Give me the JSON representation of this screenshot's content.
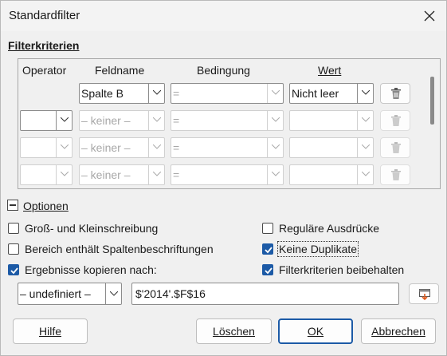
{
  "window": {
    "title": "Standardfilter"
  },
  "criteria": {
    "title": "Filterkriterien",
    "headers": {
      "operator": "Operator",
      "field": "Feldname",
      "condition": "Bedingung",
      "value": "Wert"
    },
    "rows": [
      {
        "operator": "",
        "field": "Spalte B",
        "condition": "=",
        "value": "Nicht leer",
        "enabled": true
      },
      {
        "operator": "",
        "field": "– keiner –",
        "condition": "=",
        "value": "",
        "enabled": false
      },
      {
        "operator": "",
        "field": "– keiner –",
        "condition": "=",
        "value": "",
        "enabled": false
      },
      {
        "operator": "",
        "field": "– keiner –",
        "condition": "=",
        "value": "",
        "enabled": false
      }
    ]
  },
  "options": {
    "title": "Optionen",
    "case_sensitive": {
      "label": "Groß- und Kleinschreibung",
      "checked": false
    },
    "regex": {
      "label": "Reguläre Ausdrücke",
      "checked": false
    },
    "range_has_headers": {
      "label": "Bereich enthält Spaltenbeschriftungen",
      "checked": false
    },
    "no_duplicates": {
      "label": "Keine Duplikate",
      "checked": true
    },
    "copy_results": {
      "label": "Ergebnisse kopieren nach:",
      "checked": true
    },
    "keep_criteria": {
      "label": "Filterkriterien beibehalten",
      "checked": true
    },
    "copy_target_named_range": "– undefiniert –",
    "copy_target_address": "$'2014'.$F$16"
  },
  "buttons": {
    "help": "Hilfe",
    "delete": "Löschen",
    "ok": "OK",
    "cancel": "Abbrechen"
  },
  "colors": {
    "accent": "#1c5aa6"
  }
}
